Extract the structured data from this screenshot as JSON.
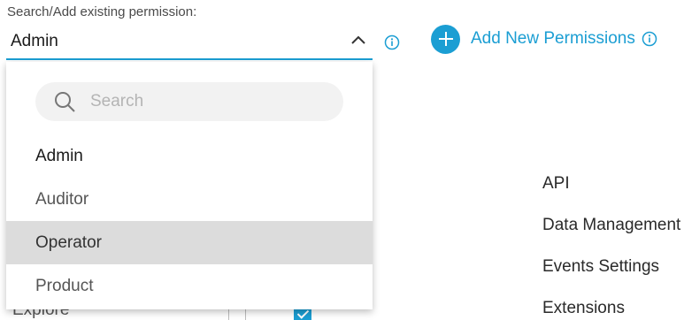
{
  "permission_select": {
    "label": "Search/Add existing permission:",
    "value": "Admin"
  },
  "add_button": {
    "label": "Add New Permissions"
  },
  "dropdown": {
    "search_placeholder": "Search",
    "options": [
      {
        "label": "Admin",
        "state": "selected"
      },
      {
        "label": "Auditor",
        "state": "normal"
      },
      {
        "label": "Operator",
        "state": "hovered"
      },
      {
        "label": "Product",
        "state": "normal"
      }
    ]
  },
  "background": {
    "categories": [
      "API",
      "Data Management",
      "Events Settings",
      "Extensions"
    ],
    "row_label": "Explore",
    "row_checkboxes": [
      false,
      true
    ]
  },
  "colors": {
    "accent": "#1b9ed3",
    "hover_bg": "#dcdcdc",
    "search_bg": "#f2f2f2"
  }
}
